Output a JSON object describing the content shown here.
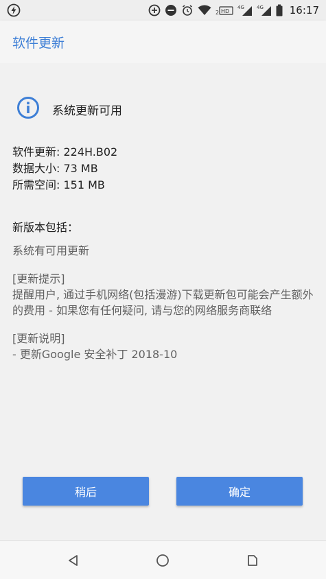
{
  "status_bar": {
    "time": "16:17",
    "icons": [
      "flash-icon",
      "data-saver-icon",
      "do-not-disturb-icon",
      "alarm-icon",
      "wifi-icon",
      "hd-icon",
      "signal-4g-icon",
      "signal-4g-icon",
      "battery-icon"
    ],
    "sim_labels": [
      "2",
      "HD",
      "4G",
      "4G"
    ]
  },
  "app_bar": {
    "title": "软件更新"
  },
  "availability": {
    "text": "系统更新可用",
    "icon": "info-icon",
    "accent": "#3e7fd6"
  },
  "details": {
    "version": "软件更新: 224H.B02",
    "size": "数据大小: 73 MB",
    "required_space": "所需空间: 151 MB"
  },
  "changelog": {
    "heading": "新版本包括：",
    "summary": "系统有可用更新",
    "tip_title": "[更新提示]",
    "tip_body": "提醒用户, 通过手机网络(包括漫游)下载更新包可能会产生额外的费用 - 如果您有任何疑问, 请与您的网络服务商联络",
    "notes_title": "[更新说明]",
    "notes_item": "- 更新Google 安全补丁 2018-10"
  },
  "buttons": {
    "later": "稍后",
    "ok": "确定",
    "color": "#4a86e0"
  },
  "nav_bar": {
    "back": "back-icon",
    "home": "home-icon",
    "recents": "recents-icon"
  }
}
